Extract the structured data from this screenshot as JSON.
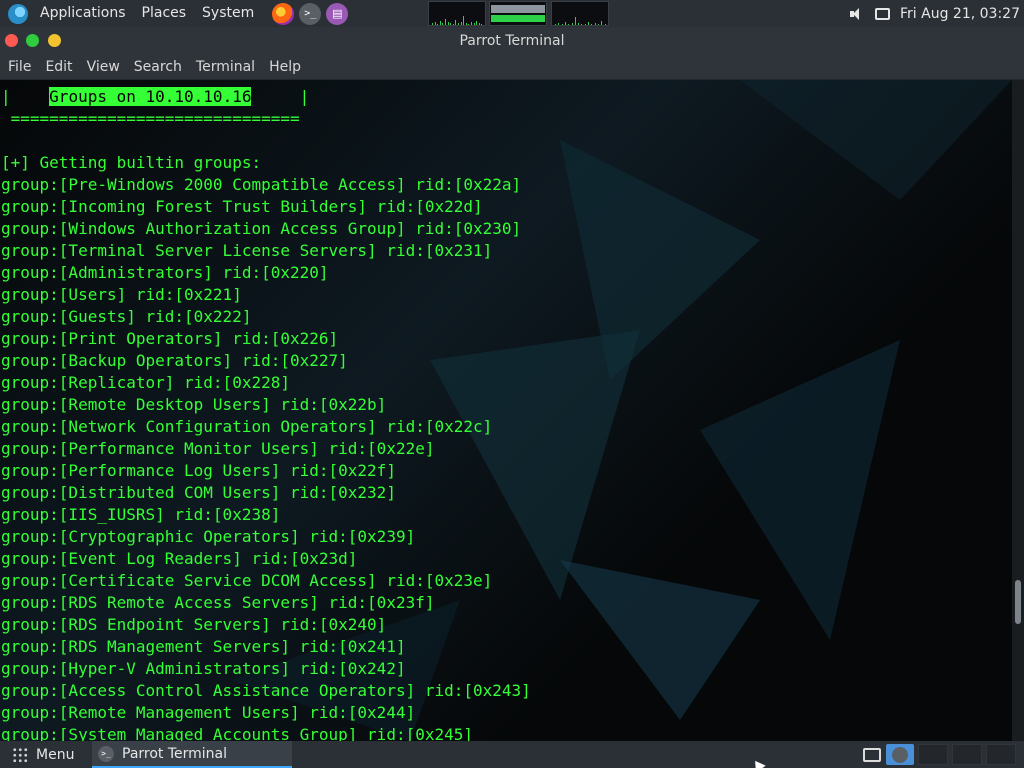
{
  "top_panel": {
    "menus": [
      "Applications",
      "Places",
      "System"
    ],
    "clock": "Fri Aug 21, 03:27",
    "launchers": [
      "firefox-icon",
      "terminal-icon",
      "notes-icon"
    ]
  },
  "window": {
    "title": "Parrot Terminal",
    "menus": [
      "File",
      "Edit",
      "View",
      "Search",
      "Terminal",
      "Help"
    ]
  },
  "terminal": {
    "header_prefix": "|    ",
    "header_highlight": "Groups on 10.10.10.16",
    "header_suffix": "     |",
    "separator": " ==============================",
    "blank": "",
    "intro": "[+] Getting builtin groups:",
    "lines": [
      "group:[Pre-Windows 2000 Compatible Access] rid:[0x22a]",
      "group:[Incoming Forest Trust Builders] rid:[0x22d]",
      "group:[Windows Authorization Access Group] rid:[0x230]",
      "group:[Terminal Server License Servers] rid:[0x231]",
      "group:[Administrators] rid:[0x220]",
      "group:[Users] rid:[0x221]",
      "group:[Guests] rid:[0x222]",
      "group:[Print Operators] rid:[0x226]",
      "group:[Backup Operators] rid:[0x227]",
      "group:[Replicator] rid:[0x228]",
      "group:[Remote Desktop Users] rid:[0x22b]",
      "group:[Network Configuration Operators] rid:[0x22c]",
      "group:[Performance Monitor Users] rid:[0x22e]",
      "group:[Performance Log Users] rid:[0x22f]",
      "group:[Distributed COM Users] rid:[0x232]",
      "group:[IIS_IUSRS] rid:[0x238]",
      "group:[Cryptographic Operators] rid:[0x239]",
      "group:[Event Log Readers] rid:[0x23d]",
      "group:[Certificate Service DCOM Access] rid:[0x23e]",
      "group:[RDS Remote Access Servers] rid:[0x23f]",
      "group:[RDS Endpoint Servers] rid:[0x240]",
      "group:[RDS Management Servers] rid:[0x241]",
      "group:[Hyper-V Administrators] rid:[0x242]",
      "group:[Access Control Assistance Operators] rid:[0x243]",
      "group:[Remote Management Users] rid:[0x244]",
      "group:[System Managed Accounts Group] rid:[0x245]"
    ],
    "text_color": "#35ff35"
  },
  "bottom_panel": {
    "menu_label": "Menu",
    "task_label": "Parrot Terminal"
  }
}
